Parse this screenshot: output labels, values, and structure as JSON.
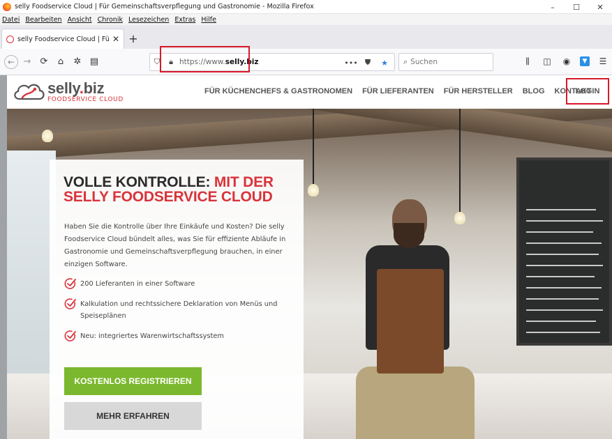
{
  "window": {
    "title": "selly Foodservice Cloud | Für Gemeinschaftsverpflegung und Gastronomie - Mozilla Firefox",
    "controls": [
      "–",
      "☐",
      "✕"
    ]
  },
  "menubar": [
    "Datei",
    "Bearbeiten",
    "Ansicht",
    "Chronik",
    "Lesezeichen",
    "Extras",
    "Hilfe"
  ],
  "tabs": [
    {
      "title": "selly Foodservice Cloud | Für Ge",
      "close": "✕"
    }
  ],
  "new_tab": "+",
  "navbar": {
    "url_prefix": "https://www.",
    "url_domain": "selly.biz",
    "page_actions": "•••",
    "search_placeholder": "Suchen"
  },
  "site": {
    "logo_name_a": "selly",
    "logo_name_dot": ".",
    "logo_name_b": "biz",
    "logo_sub": "FOODSERVICE CLOUD",
    "nav": [
      "FÜR KÜCHENCHEFS & GASTRONOMEN",
      "FÜR LIEFERANTEN",
      "FÜR HERSTELLER",
      "BLOG",
      "KONTAKT"
    ],
    "login": "LOGIN"
  },
  "hero": {
    "title_dark": "VOLLE KONTROLLE: ",
    "title_red": "MIT DER SELLY FOODSERVICE CLOUD",
    "description": "Haben Sie die Kontrolle über Ihre Einkäufe und Kosten? Die selly Foodservice Cloud bündelt alles, was Sie für effiziente Abläufe in Gastronomie und Gemeinschaftsverpflegung brauchen, in einer einzigen Software.",
    "features": [
      "200 Lieferanten in einer Software",
      "Kalkulation und rechtssichere Deklaration von Menüs und Speiseplänen",
      "Neu: integriertes Warenwirtschaftssystem"
    ],
    "cta_primary": "KOSTENLOS REGISTRIEREN",
    "cta_secondary": "MEHR ERFAHREN"
  },
  "colors": {
    "brand_red": "#d9333a",
    "cta_green": "#7cb82f",
    "highlight_red": "#d7182a"
  }
}
